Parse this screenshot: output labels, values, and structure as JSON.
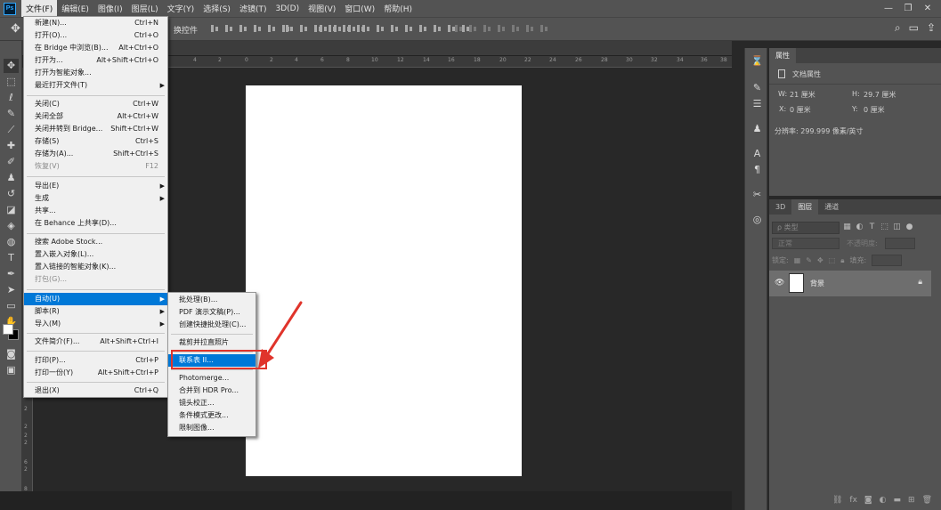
{
  "menubar": {
    "items": [
      "文件(F)",
      "编辑(E)",
      "图像(I)",
      "图层(L)",
      "文字(Y)",
      "选择(S)",
      "滤镜(T)",
      "3D(D)",
      "视图(V)",
      "窗口(W)",
      "帮助(H)"
    ],
    "window_controls": [
      "—",
      "❐",
      "✕"
    ]
  },
  "options": {
    "label": "换控件"
  },
  "rulers": {
    "h_ticks": [
      "4",
      "2",
      "0",
      "2",
      "4",
      "6",
      "8",
      "10",
      "12",
      "14",
      "16",
      "18",
      "20",
      "22",
      "24",
      "26",
      "28",
      "30",
      "32",
      "34",
      "36",
      "38"
    ],
    "v_ticks": [
      "2",
      "2",
      "2",
      "2",
      "6",
      "2",
      "8",
      "3"
    ]
  },
  "file_menu": {
    "items": [
      {
        "label": "新建(N)...",
        "shortcut": "Ctrl+N"
      },
      {
        "label": "打开(O)...",
        "shortcut": "Ctrl+O"
      },
      {
        "label": "在 Bridge 中浏览(B)...",
        "shortcut": "Alt+Ctrl+O"
      },
      {
        "label": "打开为...",
        "shortcut": "Alt+Shift+Ctrl+O"
      },
      {
        "label": "打开为智能对象...",
        "shortcut": ""
      },
      {
        "label": "最近打开文件(T)",
        "shortcut": ""
      },
      {
        "label": "关闭(C)",
        "shortcut": "Ctrl+W"
      },
      {
        "label": "关闭全部",
        "shortcut": "Alt+Ctrl+W"
      },
      {
        "label": "关闭并转到 Bridge...",
        "shortcut": "Shift+Ctrl+W"
      },
      {
        "label": "存储(S)",
        "shortcut": "Ctrl+S"
      },
      {
        "label": "存储为(A)...",
        "shortcut": "Shift+Ctrl+S"
      },
      {
        "label": "恢复(V)",
        "shortcut": "F12"
      },
      {
        "label": "导出(E)",
        "shortcut": ""
      },
      {
        "label": "生成",
        "shortcut": ""
      },
      {
        "label": "共享...",
        "shortcut": ""
      },
      {
        "label": "在 Behance 上共享(D)...",
        "shortcut": ""
      },
      {
        "label": "搜索 Adobe Stock...",
        "shortcut": ""
      },
      {
        "label": "置入嵌入对象(L)...",
        "shortcut": ""
      },
      {
        "label": "置入链接的智能对象(K)...",
        "shortcut": ""
      },
      {
        "label": "打包(G)...",
        "shortcut": ""
      },
      {
        "label": "自动(U)",
        "shortcut": ""
      },
      {
        "label": "脚本(R)",
        "shortcut": ""
      },
      {
        "label": "导入(M)",
        "shortcut": ""
      },
      {
        "label": "文件简介(F)...",
        "shortcut": "Alt+Shift+Ctrl+I"
      },
      {
        "label": "打印(P)...",
        "shortcut": "Ctrl+P"
      },
      {
        "label": "打印一份(Y)",
        "shortcut": "Alt+Shift+Ctrl+P"
      },
      {
        "label": "退出(X)",
        "shortcut": "Ctrl+Q"
      }
    ]
  },
  "auto_submenu": {
    "items": [
      "批处理(B)...",
      "PDF 演示文稿(P)...",
      "创建快捷批处理(C)...",
      "裁剪并拉直照片",
      "联系表 II...",
      "Photomerge...",
      "合并到 HDR Pro...",
      "镜头校正...",
      "条件模式更改...",
      "限制图像..."
    ]
  },
  "properties": {
    "tab": "属性",
    "title": "文档属性",
    "w_label": "W:",
    "w_value": "21 厘米",
    "h_label": "H:",
    "h_value": "29.7 厘米",
    "x_label": "X:",
    "x_value": "0 厘米",
    "y_label": "Y:",
    "y_value": "0 厘米",
    "resolution": "分辨率: 299.999 像素/英寸"
  },
  "layers": {
    "tabs": [
      "3D",
      "图层",
      "通道"
    ],
    "filter_kind": "ρ 类型",
    "blend_mode": "正常",
    "opacity_label": "不透明度:",
    "lock_label": "锁定:",
    "fill_label": "填充:",
    "layer_name": "背景"
  },
  "colors": {
    "accent": "#0078d7",
    "annotation": "#e0342b"
  }
}
